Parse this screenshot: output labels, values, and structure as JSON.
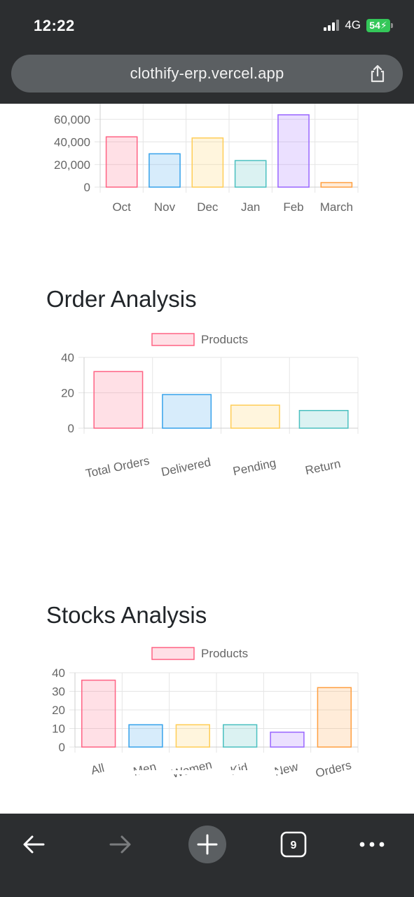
{
  "status_bar": {
    "time": "12:22",
    "network": "4G",
    "battery": "54"
  },
  "browser": {
    "url": "clothify-erp.vercel.app",
    "tab_count": "9"
  },
  "colors": {
    "pink": "#ff6384",
    "blue": "#36a2eb",
    "yellow": "#ffcd56",
    "teal": "#4bc0c0",
    "purple": "#9966ff",
    "orange": "#ff9f40"
  },
  "sales_chart": {
    "chart_data": {
      "type": "bar",
      "categories": [
        "Oct",
        "Nov",
        "Dec",
        "Jan",
        "Feb",
        "March"
      ],
      "values": [
        44500,
        29500,
        43500,
        23500,
        64000,
        4000
      ],
      "yticks": [
        "60,000",
        "40,000",
        "20,000",
        "0"
      ],
      "ylim": [
        0,
        67000
      ],
      "grid": true
    }
  },
  "order_analysis": {
    "title": "Order Analysis",
    "chart_data": {
      "type": "bar",
      "legend": "Products",
      "categories": [
        "Total Orders",
        "Delivered",
        "Pending",
        "Return"
      ],
      "values": [
        32,
        19,
        13,
        10
      ],
      "yticks": [
        "40",
        "20",
        "0"
      ],
      "ylim": [
        0,
        40
      ],
      "grid": true
    }
  },
  "stocks_analysis": {
    "title": "Stocks Analysis",
    "chart_data": {
      "type": "bar",
      "legend": "Products",
      "categories": [
        "All",
        "Men",
        "Women",
        "Kid",
        "New",
        "Orders"
      ],
      "values": [
        36,
        12,
        12,
        12,
        8,
        32
      ],
      "yticks": [
        "40",
        "30",
        "20",
        "10",
        "0"
      ],
      "ylim": [
        0,
        40
      ],
      "grid": true
    }
  }
}
